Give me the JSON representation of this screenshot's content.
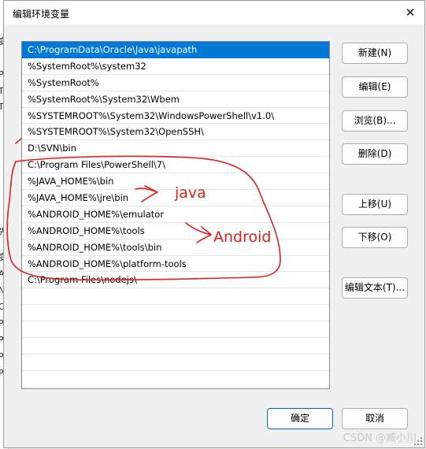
{
  "background_window": {
    "fragments": [
      "变",
      "Pa",
      "TE",
      "TN",
      "先",
      "变",
      "A",
      "NI",
      "O",
      "Pa",
      "P",
      "PC",
      "PF"
    ]
  },
  "dialog": {
    "title": "编辑环境变量",
    "close_glyph": "✕"
  },
  "path_list": {
    "items": [
      {
        "text": "C:\\ProgramData\\Oracle\\Java\\javapath",
        "selected": true
      },
      {
        "text": "%SystemRoot%\\system32",
        "selected": false
      },
      {
        "text": "%SystemRoot%",
        "selected": false
      },
      {
        "text": "%SystemRoot%\\System32\\Wbem",
        "selected": false
      },
      {
        "text": "%SYSTEMROOT%\\System32\\WindowsPowerShell\\v1.0\\",
        "selected": false
      },
      {
        "text": "%SYSTEMROOT%\\System32\\OpenSSH\\",
        "selected": false
      },
      {
        "text": "D:\\SVN\\bin",
        "selected": false
      },
      {
        "text": "C:\\Program Files\\PowerShell\\7\\",
        "selected": false
      },
      {
        "text": "%JAVA_HOME%\\bin",
        "selected": false
      },
      {
        "text": "%JAVA_HOME%\\jre\\bin",
        "selected": false
      },
      {
        "text": "%ANDROID_HOME%\\emulator",
        "selected": false
      },
      {
        "text": "%ANDROID_HOME%\\tools",
        "selected": false
      },
      {
        "text": "%ANDROID_HOME%\\tools\\bin",
        "selected": false
      },
      {
        "text": "%ANDROID_HOME%\\platform-tools",
        "selected": false
      },
      {
        "text": "C:\\Program Files\\nodejs\\",
        "selected": false
      },
      {
        "text": "",
        "selected": false
      },
      {
        "text": "",
        "selected": false
      },
      {
        "text": "",
        "selected": false
      },
      {
        "text": "",
        "selected": false
      },
      {
        "text": "",
        "selected": false
      },
      {
        "text": "",
        "selected": false
      }
    ]
  },
  "buttons": {
    "new": "新建(N)",
    "edit": "编辑(E)",
    "browse": "浏览(B)...",
    "delete": "删除(D)",
    "move_up": "上移(U)",
    "move_down": "下移(O)",
    "edit_text": "编辑文本(T)...",
    "ok": "确定",
    "cancel": "取消"
  },
  "annotations": {
    "java_label": "java",
    "android_label": "Android",
    "color": "#e0201b"
  },
  "watermark": "CSDN @臧小川",
  "colors": {
    "selection": "#0078d7",
    "primary_button_border": "#0067c0"
  }
}
